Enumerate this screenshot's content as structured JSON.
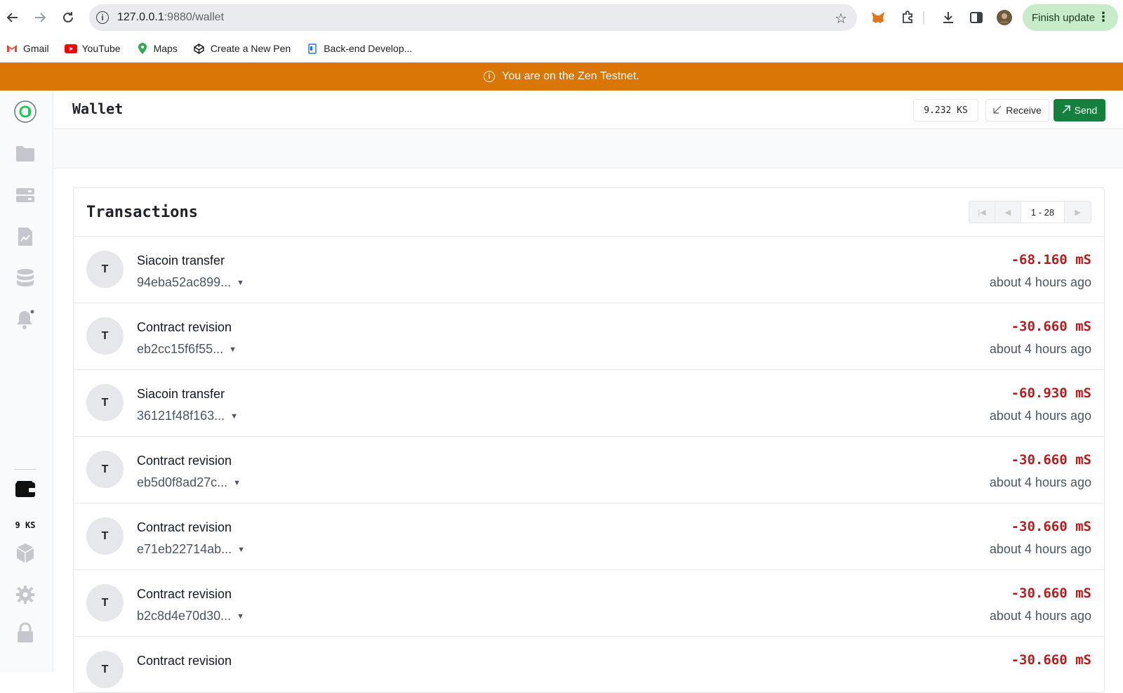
{
  "browser": {
    "url_host": "127.0.0.1",
    "url_path": ":9880/wallet",
    "finish_update_label": "Finish update",
    "bookmarks": [
      {
        "label": "Gmail"
      },
      {
        "label": "YouTube"
      },
      {
        "label": "Maps"
      },
      {
        "label": "Create a New Pen"
      },
      {
        "label": "Back-end Develop..."
      }
    ]
  },
  "banner": {
    "text": "You are on the Zen Testnet."
  },
  "sidebar": {
    "balance": "9 KS"
  },
  "header": {
    "title": "Wallet",
    "balance": "9.232 KS",
    "receive_label": "Receive",
    "send_label": "Send"
  },
  "transactions": {
    "title": "Transactions",
    "page_range": "1 - 28",
    "items": [
      {
        "initial": "T",
        "type": "Siacoin transfer",
        "id": "94eba52ac899...",
        "amount": "-68.160 mS",
        "time": "about 4 hours ago"
      },
      {
        "initial": "T",
        "type": "Contract revision",
        "id": "eb2cc15f6f55...",
        "amount": "-30.660 mS",
        "time": "about 4 hours ago"
      },
      {
        "initial": "T",
        "type": "Siacoin transfer",
        "id": "36121f48f163...",
        "amount": "-60.930 mS",
        "time": "about 4 hours ago"
      },
      {
        "initial": "T",
        "type": "Contract revision",
        "id": "eb5d0f8ad27c...",
        "amount": "-30.660 mS",
        "time": "about 4 hours ago"
      },
      {
        "initial": "T",
        "type": "Contract revision",
        "id": "e71eb22714ab...",
        "amount": "-30.660 mS",
        "time": "about 4 hours ago"
      },
      {
        "initial": "T",
        "type": "Contract revision",
        "id": "b2c8d4e70d30...",
        "amount": "-30.660 mS",
        "time": "about 4 hours ago"
      },
      {
        "initial": "T",
        "type": "Contract revision",
        "id": "",
        "amount": "-30.660 mS",
        "time": ""
      }
    ]
  },
  "colors": {
    "banner": "#d97706",
    "send": "#15803d",
    "amount_negative": "#b91c1c",
    "finish_update": "#c8ecc9"
  }
}
